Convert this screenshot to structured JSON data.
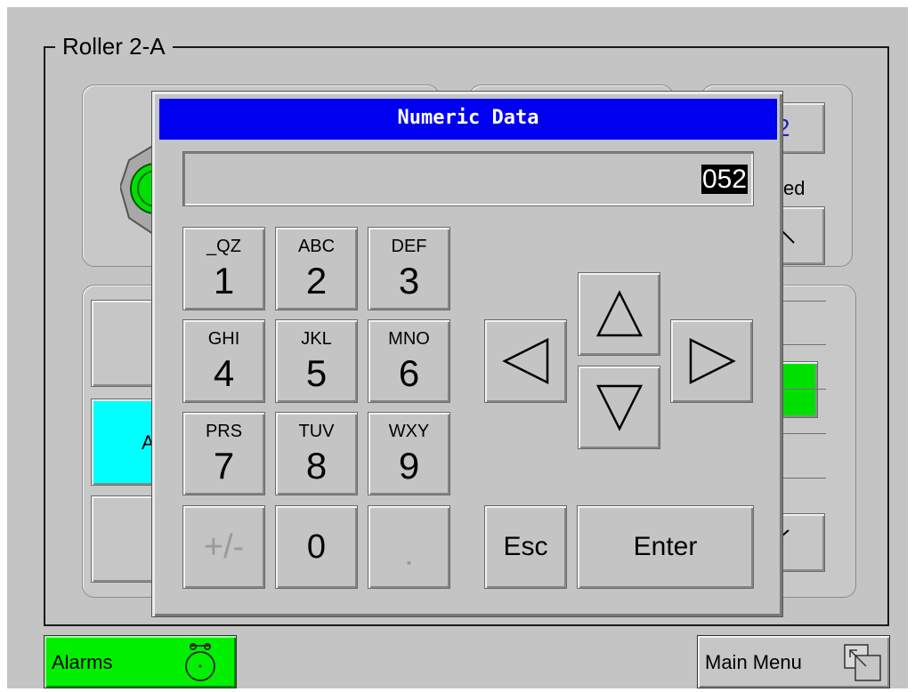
{
  "screen": {
    "group_title": "Roller 2-A",
    "background_fragments": {
      "partial_value": "2",
      "partial_label": "ed",
      "partial_button_letter": "A"
    }
  },
  "dialog": {
    "title": "Numeric Data",
    "display_value": "052",
    "keys": [
      {
        "letters": "_QZ",
        "digit": "1"
      },
      {
        "letters": "ABC",
        "digit": "2"
      },
      {
        "letters": "DEF",
        "digit": "3"
      },
      {
        "letters": "GHI",
        "digit": "4"
      },
      {
        "letters": "JKL",
        "digit": "5"
      },
      {
        "letters": "MNO",
        "digit": "6"
      },
      {
        "letters": "PRS",
        "digit": "7"
      },
      {
        "letters": "TUV",
        "digit": "8"
      },
      {
        "letters": "WXY",
        "digit": "9"
      }
    ],
    "plus_minus": "+/-",
    "zero": "0",
    "decimal": ".",
    "esc": "Esc",
    "enter": "Enter",
    "arrow_icons": [
      "arrow-up-icon",
      "arrow-down-icon",
      "arrow-left-icon",
      "arrow-right-icon"
    ]
  },
  "footer": {
    "alarms_label": "Alarms",
    "main_menu_label": "Main Menu"
  },
  "colors": {
    "title_bar": "#0000f0",
    "alarms": "#00f000",
    "cyan_button": "#00ffff",
    "green_indicator": "#00e000",
    "panel": "#c4c4c4"
  }
}
